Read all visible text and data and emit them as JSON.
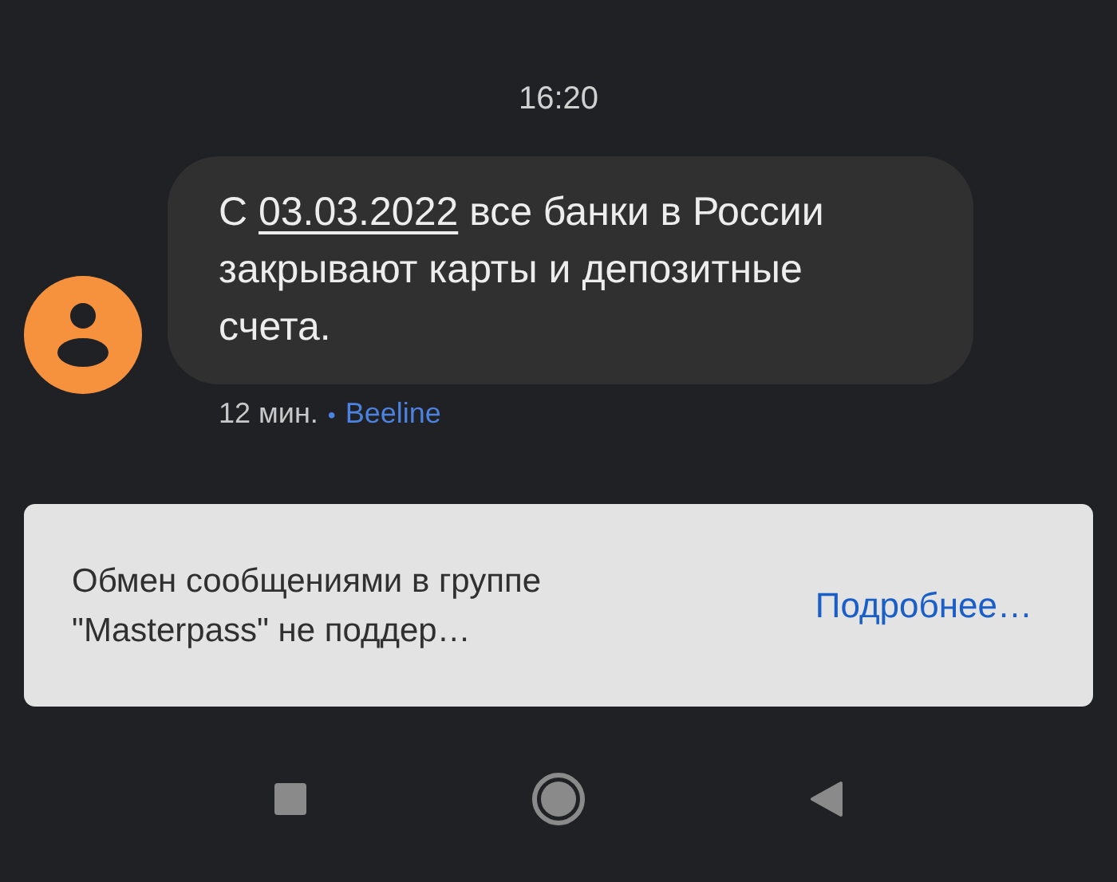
{
  "time": "16:20",
  "message": {
    "parts": [
      {
        "kind": "text",
        "text": "С "
      },
      {
        "kind": "link",
        "text": "03.03.2022"
      },
      {
        "kind": "text",
        "text": " все банки в России закрывают карты и депозитные счета."
      }
    ],
    "age": "12 мин.",
    "separator": "•",
    "sender": "Beeline"
  },
  "snackbar": {
    "text": "Обмен сообщениями в группе \"Masterpass\" не поддер…",
    "action": "Подробнее…"
  },
  "nav_bar": [
    {
      "kind": "recents"
    },
    {
      "kind": "home"
    },
    {
      "kind": "back"
    }
  ]
}
